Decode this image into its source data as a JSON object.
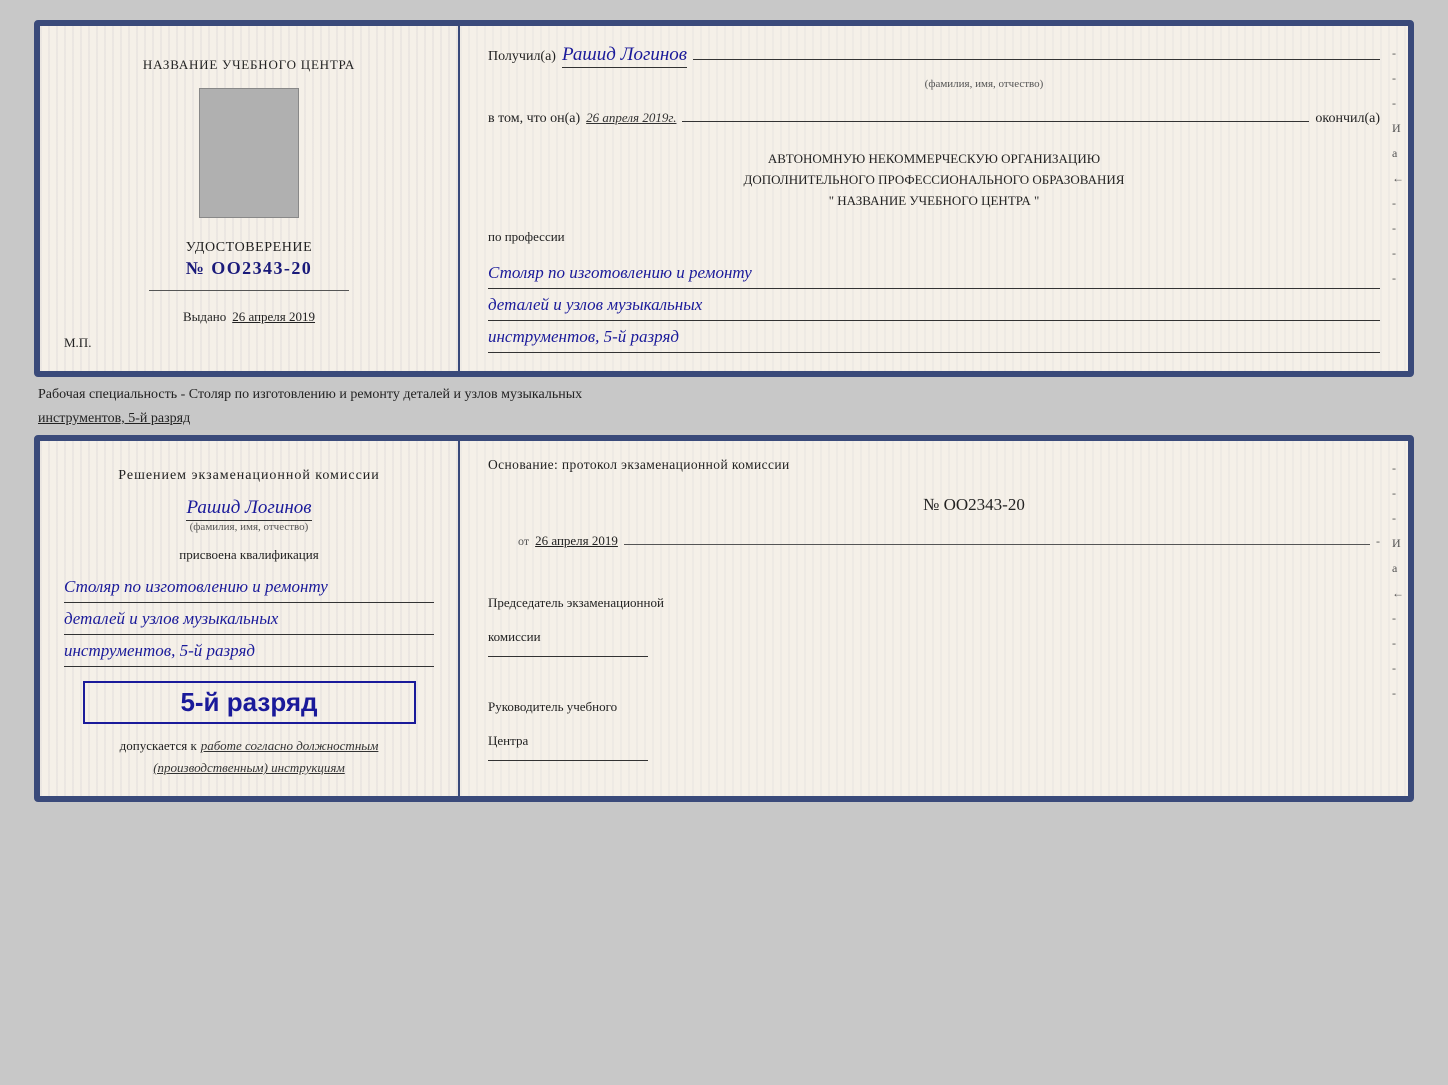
{
  "top_doc": {
    "left": {
      "center_name": "НАЗВАНИЕ УЧЕБНОГО ЦЕНТРА",
      "cert_title": "УДОСТОВЕРЕНИЕ",
      "cert_number": "№ OO2343-20",
      "issued_prefix": "Выдано",
      "issued_date": "26 апреля 2019",
      "mp_label": "М.П."
    },
    "right": {
      "received_prefix": "Получил(а)",
      "received_name": "Рашид Логинов",
      "fio_label": "(фамилия, имя, отчество)",
      "inthat_prefix": "в том, что он(а)",
      "inthat_date": "26 апреля 2019г.",
      "inthat_suffix": "окончил(а)",
      "org_line1": "АВТОНОМНУЮ НЕКОММЕРЧЕСКУЮ ОРГАНИЗАЦИЮ",
      "org_line2": "ДОПОЛНИТЕЛЬНОГО ПРОФЕССИОНАЛЬНОГО ОБРАЗОВАНИЯ",
      "org_line3": "\"    НАЗВАНИЕ УЧЕБНОГО ЦЕНТРА    \"",
      "profession_label": "по профессии",
      "profession_line1": "Столяр по изготовлению и ремонту",
      "profession_line2": "деталей и узлов музыкальных",
      "profession_line3": "инструментов, 5-й разряд"
    }
  },
  "between_label": "Рабочая специальность - Столяр по изготовлению и ремонту деталей и узлов музыкальных",
  "between_label2": "инструментов, 5-й разряд",
  "bottom_doc": {
    "left": {
      "decision_line1": "Решением  экзаменационной  комиссии",
      "person_name": "Рашид Логинов",
      "fio_label": "(фамилия, имя, отчество)",
      "qualification_label": "присвоена квалификация",
      "qual_line1": "Столяр по изготовлению и ремонту",
      "qual_line2": "деталей и узлов музыкальных",
      "qual_line3": "инструментов, 5-й разряд",
      "highlight_text": "5-й разряд",
      "admitted_prefix": "допускается к",
      "admitted_text": "работе согласно должностным",
      "admitted_text2": "(производственным) инструкциям"
    },
    "right": {
      "basis_line": "Основание:  протокол  экзаменационной  комиссии",
      "protocol_number": "№  OO2343-20",
      "from_prefix": "от",
      "from_date": "26 апреля 2019",
      "chairman_line1": "Председатель экзаменационной",
      "chairman_line2": "комиссии",
      "head_line1": "Руководитель учебного",
      "head_line2": "Центра"
    }
  },
  "dashes": [
    "-",
    "-",
    "-",
    "И",
    "а",
    "←",
    "-",
    "-",
    "-",
    "-"
  ]
}
